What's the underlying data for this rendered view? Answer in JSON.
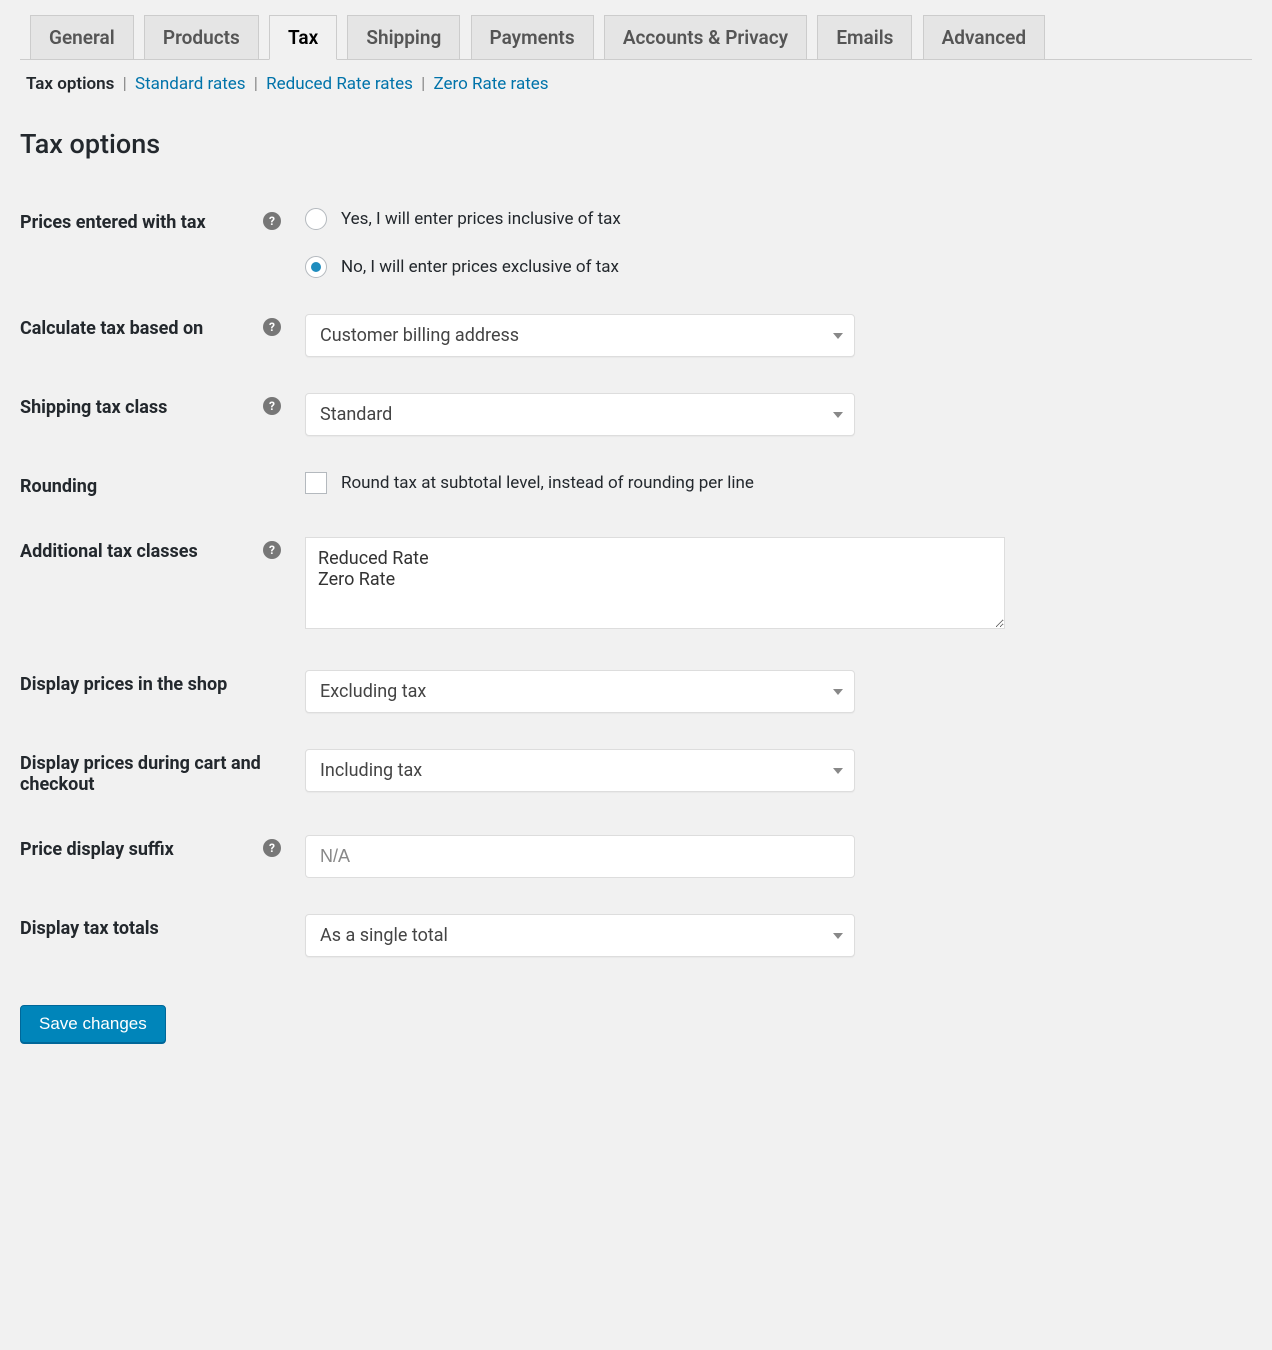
{
  "tabs": {
    "general": "General",
    "products": "Products",
    "tax": "Tax",
    "shipping": "Shipping",
    "payments": "Payments",
    "accounts": "Accounts & Privacy",
    "emails": "Emails",
    "advanced": "Advanced"
  },
  "subnav": {
    "tax_options": "Tax options",
    "standard_rates": "Standard rates",
    "reduced_rate_rates": "Reduced Rate rates",
    "zero_rate_rates": "Zero Rate rates"
  },
  "section_title": "Tax options",
  "fields": {
    "prices_entered_label": "Prices entered with tax",
    "prices_entered_yes": "Yes, I will enter prices inclusive of tax",
    "prices_entered_no": "No, I will enter prices exclusive of tax",
    "calculate_label": "Calculate tax based on",
    "calculate_value": "Customer billing address",
    "shipping_class_label": "Shipping tax class",
    "shipping_class_value": "Standard",
    "rounding_label": "Rounding",
    "rounding_check_label": "Round tax at subtotal level, instead of rounding per line",
    "additional_classes_label": "Additional tax classes",
    "additional_classes_value": "Reduced Rate\nZero Rate",
    "display_shop_label": "Display prices in the shop",
    "display_shop_value": "Excluding tax",
    "display_cart_label": "Display prices during cart and checkout",
    "display_cart_value": "Including tax",
    "suffix_label": "Price display suffix",
    "suffix_placeholder": "N/A",
    "totals_label": "Display tax totals",
    "totals_value": "As a single total"
  },
  "buttons": {
    "save": "Save changes"
  }
}
